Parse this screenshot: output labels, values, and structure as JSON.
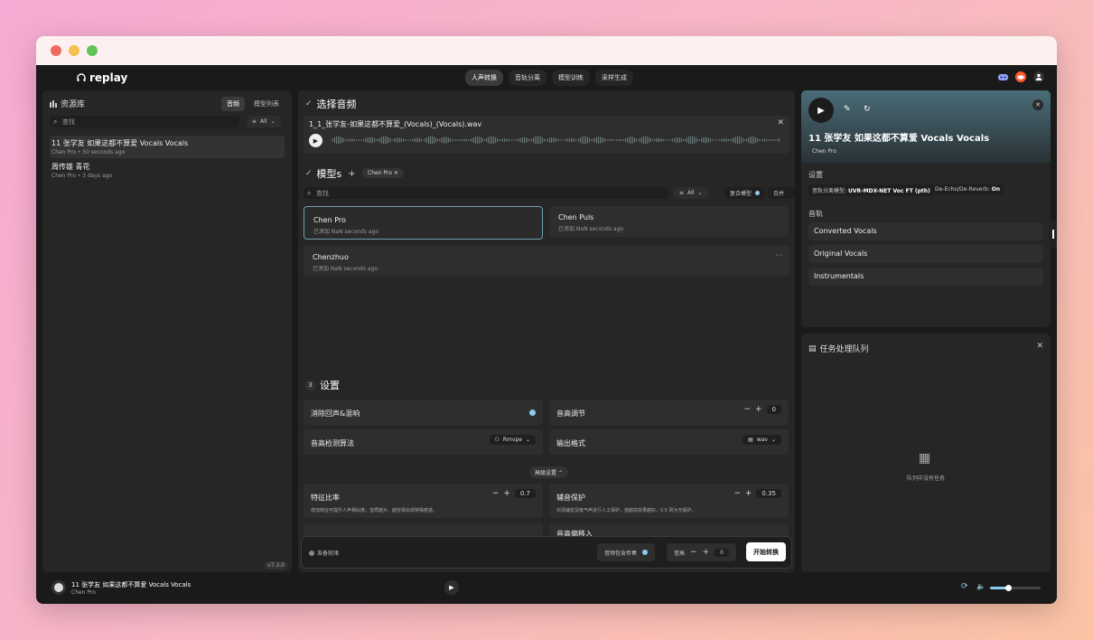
{
  "app": {
    "logo": "replay"
  },
  "nav": {
    "tabs": [
      "人声转换",
      "音轨分离",
      "模型训练",
      "采样生成"
    ],
    "active": 0
  },
  "library": {
    "title": "资源库",
    "tabs": [
      "音频",
      "模型列表"
    ],
    "search_placeholder": "查找",
    "filter": "All",
    "items": [
      {
        "title": "11 张学友 如果这都不算爱 Vocals Vocals",
        "sub": "Chen Pro • 50 seconds ago"
      },
      {
        "title": "周传雄 青花",
        "sub": "Chen Pro • 3 days ago"
      }
    ],
    "version": "v7.3.0"
  },
  "audio": {
    "title": "选择音频",
    "filename": "1_1_张学友-如果这都不算爱_(Vocals)_(Vocals).wav"
  },
  "models": {
    "title": "模型s",
    "plus": "+",
    "selected_chip": "Chen Pro",
    "search_placeholder": "查找",
    "filter": "All",
    "mix_label": "复合模型",
    "merge_label": "合并",
    "cards": [
      {
        "name": "Chen Pro",
        "desc": "已添加 NaN seconds ago"
      },
      {
        "name": "Chen Puls",
        "desc": "已添加 NaN seconds ago"
      },
      {
        "name": "Chenzhuo",
        "desc": "已添加 NaN seconds ago"
      }
    ]
  },
  "settings": {
    "step": "3",
    "title": "设置",
    "echo": "消除回声&混响",
    "pitch": "音高调节",
    "pitch_val": "0",
    "detect": "音高检测算法",
    "detect_val": "Rmvpe",
    "format": "输出格式",
    "format_val": "wav",
    "advanced": "高级设置",
    "feature": "特征比率",
    "feature_desc": "增加特征可提升人声相似度。音质越大，越容易出现特殊痕迹。",
    "feature_val": "0.7",
    "protect": "辅音保护",
    "protect_desc": "对清辅音及吸气声进行人工保护，值越高效果越好，0.5 则为无保护。",
    "protect_val": "0.35",
    "next_label": "音高偏移入"
  },
  "bottombar": {
    "status": "准备就绪",
    "include_acc": "音频包含伴奏",
    "pitch": "音高",
    "pitch_val": "0",
    "start": "开始转换"
  },
  "detail": {
    "title": "11 张学友 如果这都不算爱 Vocals Vocals",
    "artist": "Chen Pro",
    "settings_label": "设置",
    "tag1_key": "音轨分离模型:",
    "tag1_val": "UVR-MDX-NET Voc FT (pth)",
    "tag2_key": "De-Echo/De-Reverb:",
    "tag2_val": "On",
    "tracks_label": "音轨",
    "tracks": [
      "Converted Vocals",
      "Original Vocals",
      "Instrumentals"
    ]
  },
  "queue": {
    "title": "任务处理队列",
    "empty": "队列中没有任务"
  },
  "player": {
    "title": "11 张学友 如果这都不算爱 Vocals Vocals",
    "artist": "Chen Pro",
    "volume": 0.35
  },
  "colors": {
    "accent": "#8fcaf0",
    "panel": "#262626",
    "bg": "#1a1a1a"
  }
}
